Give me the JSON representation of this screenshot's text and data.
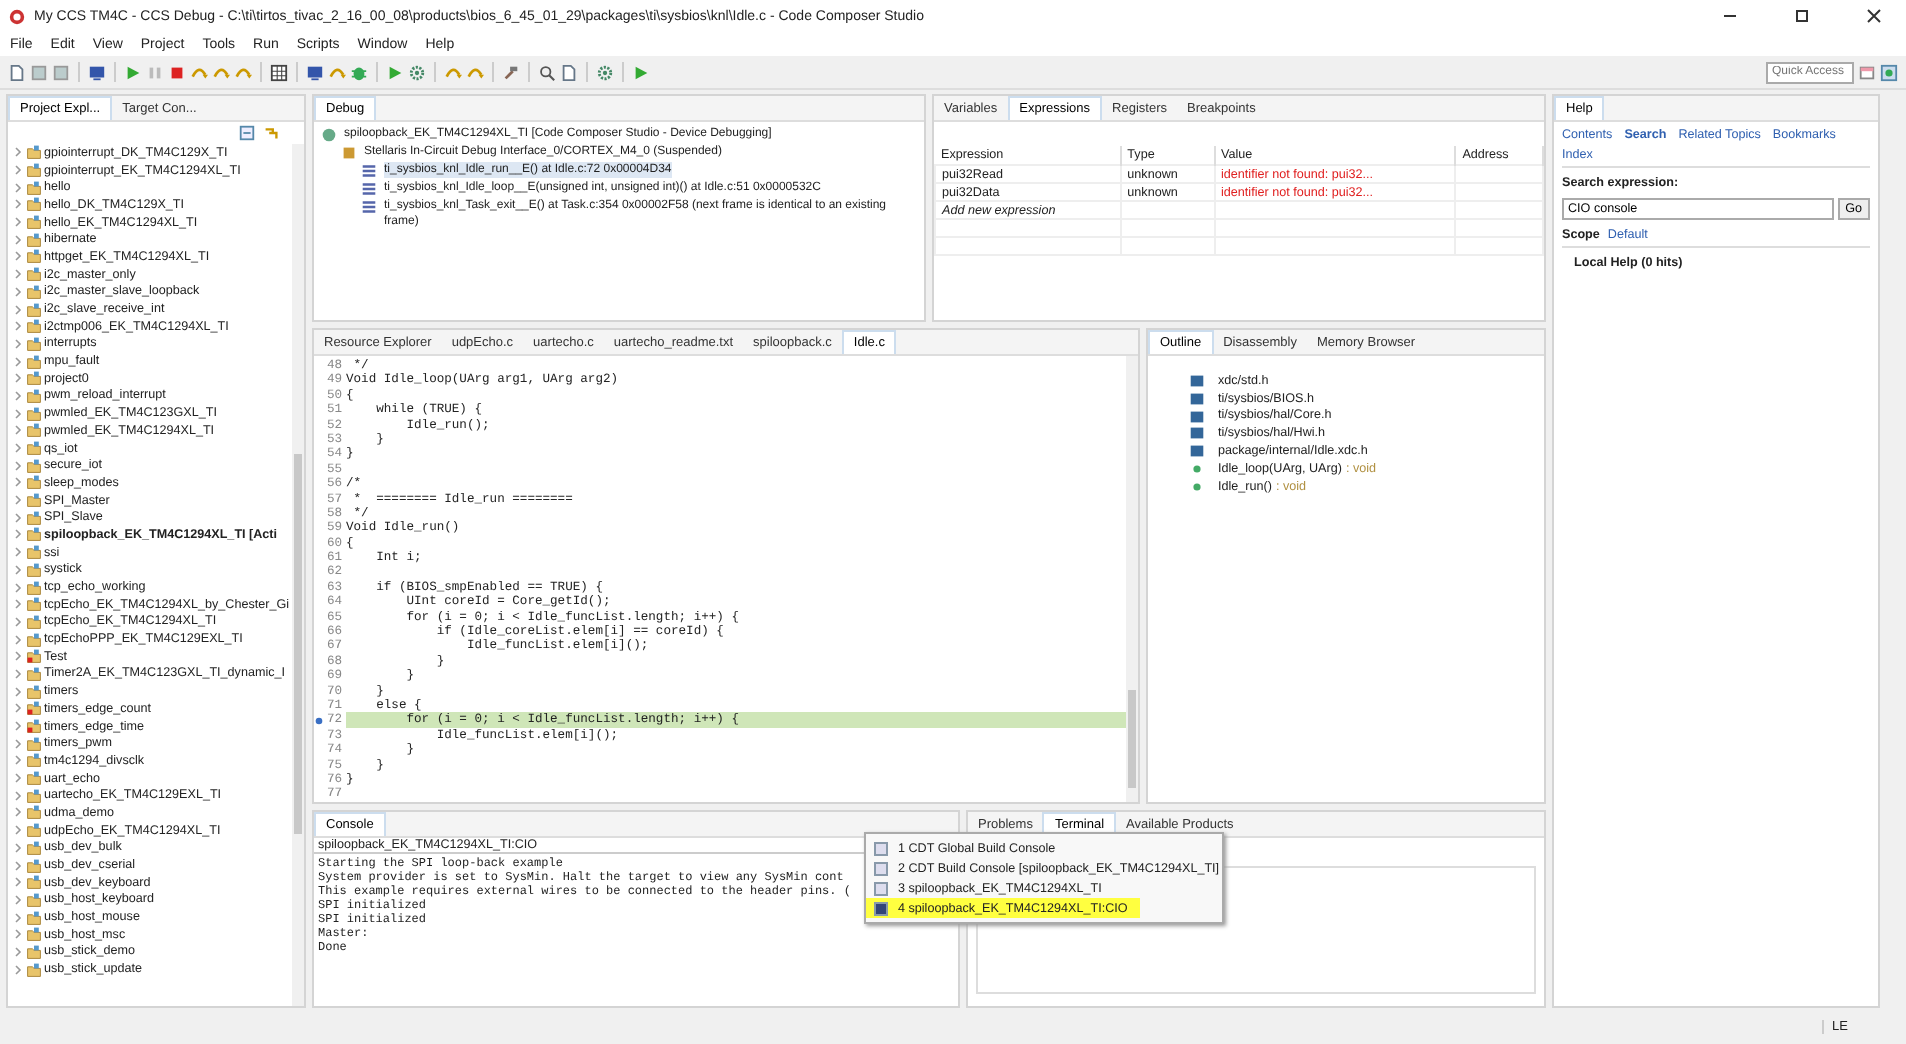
{
  "window": {
    "title": "My CCS TM4C - CCS Debug - C:\\ti\\tirtos_tivac_2_16_00_08\\products\\bios_6_45_01_29\\packages\\ti\\sysbios\\knl\\Idle.c - Code Composer Studio"
  },
  "menu": [
    "File",
    "Edit",
    "View",
    "Project",
    "Tools",
    "Run",
    "Scripts",
    "Window",
    "Help"
  ],
  "quick_access": {
    "placeholder": "Quick Access"
  },
  "project_explorer": {
    "tabs": [
      {
        "label": "Project Expl...",
        "selected": true
      },
      {
        "label": "Target Con...",
        "selected": false
      }
    ],
    "items": [
      {
        "label": "gpiointerrupt_DK_TM4C129X_TI",
        "active": false,
        "error": false
      },
      {
        "label": "gpiointerrupt_EK_TM4C1294XL_TI",
        "active": false,
        "error": false
      },
      {
        "label": "hello",
        "active": false,
        "error": false
      },
      {
        "label": "hello_DK_TM4C129X_TI",
        "active": false,
        "error": false
      },
      {
        "label": "hello_EK_TM4C1294XL_TI",
        "active": false,
        "error": false
      },
      {
        "label": "hibernate",
        "active": false,
        "error": false
      },
      {
        "label": "httpget_EK_TM4C1294XL_TI",
        "active": false,
        "error": false
      },
      {
        "label": "i2c_master_only",
        "active": false,
        "error": false
      },
      {
        "label": "i2c_master_slave_loopback",
        "active": false,
        "error": false
      },
      {
        "label": "i2c_slave_receive_int",
        "active": false,
        "error": false
      },
      {
        "label": "i2ctmp006_EK_TM4C1294XL_TI",
        "active": false,
        "error": false
      },
      {
        "label": "interrupts",
        "active": false,
        "error": false
      },
      {
        "label": "mpu_fault",
        "active": false,
        "error": false
      },
      {
        "label": "project0",
        "active": false,
        "error": false
      },
      {
        "label": "pwm_reload_interrupt",
        "active": false,
        "error": false
      },
      {
        "label": "pwmled_EK_TM4C123GXL_TI",
        "active": false,
        "error": false
      },
      {
        "label": "pwmled_EK_TM4C1294XL_TI",
        "active": false,
        "error": false
      },
      {
        "label": "qs_iot",
        "active": false,
        "error": false
      },
      {
        "label": "secure_iot",
        "active": false,
        "error": false
      },
      {
        "label": "sleep_modes",
        "active": false,
        "error": false
      },
      {
        "label": "SPI_Master",
        "active": false,
        "error": false
      },
      {
        "label": "SPI_Slave",
        "active": false,
        "error": false
      },
      {
        "label": "spiloopback_EK_TM4C1294XL_TI [Acti",
        "active": true,
        "error": false
      },
      {
        "label": "ssi",
        "active": false,
        "error": false
      },
      {
        "label": "systick",
        "active": false,
        "error": false
      },
      {
        "label": "tcp_echo_working",
        "active": false,
        "error": false
      },
      {
        "label": "tcpEcho_EK_TM4C1294XL_by_Chester_Gi",
        "active": false,
        "error": false
      },
      {
        "label": "tcpEcho_EK_TM4C1294XL_TI",
        "active": false,
        "error": false
      },
      {
        "label": "tcpEchoPPP_EK_TM4C129EXL_TI",
        "active": false,
        "error": false
      },
      {
        "label": "Test",
        "active": false,
        "error": true
      },
      {
        "label": "Timer2A_EK_TM4C123GXL_TI_dynamic_I",
        "active": false,
        "error": false
      },
      {
        "label": "timers",
        "active": false,
        "error": false
      },
      {
        "label": "timers_edge_count",
        "active": false,
        "error": true
      },
      {
        "label": "timers_edge_time",
        "active": false,
        "error": true
      },
      {
        "label": "timers_pwm",
        "active": false,
        "error": false
      },
      {
        "label": "tm4c1294_divsclk",
        "active": false,
        "error": false
      },
      {
        "label": "uart_echo",
        "active": false,
        "error": false
      },
      {
        "label": "uartecho_EK_TM4C129EXL_TI",
        "active": false,
        "error": false
      },
      {
        "label": "udma_demo",
        "active": false,
        "error": false
      },
      {
        "label": "udpEcho_EK_TM4C1294XL_TI",
        "active": false,
        "error": false
      },
      {
        "label": "usb_dev_bulk",
        "active": false,
        "error": false
      },
      {
        "label": "usb_dev_cserial",
        "active": false,
        "error": false
      },
      {
        "label": "usb_dev_keyboard",
        "active": false,
        "error": false
      },
      {
        "label": "usb_host_keyboard",
        "active": false,
        "error": false
      },
      {
        "label": "usb_host_mouse",
        "active": false,
        "error": false
      },
      {
        "label": "usb_host_msc",
        "active": false,
        "error": false
      },
      {
        "label": "usb_stick_demo",
        "active": false,
        "error": false
      },
      {
        "label": "usb_stick_update",
        "active": false,
        "error": false
      }
    ]
  },
  "debug": {
    "tabs": [
      {
        "label": "Debug",
        "selected": true
      }
    ],
    "session": "spiloopback_EK_TM4C1294XL_TI [Code Composer Studio - Device Debugging]",
    "target": "Stellaris In-Circuit Debug Interface_0/CORTEX_M4_0 (Suspended)",
    "frames": [
      {
        "label": "ti_sysbios_knl_Idle_run__E() at Idle.c:72 0x00004D34",
        "selected": true
      },
      {
        "label": "ti_sysbios_knl_Idle_loop__E(unsigned int, unsigned int)() at Idle.c:51 0x0000532C",
        "selected": false
      },
      {
        "label": "ti_sysbios_knl_Task_exit__E() at Task.c:354 0x00002F58  (next frame is identical to an existing frame)",
        "selected": false
      }
    ]
  },
  "expressions": {
    "tabs": [
      {
        "label": "Variables",
        "selected": false
      },
      {
        "label": "Expressions",
        "selected": true
      },
      {
        "label": "Registers",
        "selected": false
      },
      {
        "label": "Breakpoints",
        "selected": false
      }
    ],
    "columns": [
      "Expression",
      "Type",
      "Value",
      "Address"
    ],
    "rows": [
      {
        "expression": "pui32Read",
        "type": "unknown",
        "value": "identifier not found: pui32..."
      },
      {
        "expression": "pui32Data",
        "type": "unknown",
        "value": "identifier not found: pui32..."
      }
    ],
    "add_row": "Add new expression"
  },
  "help": {
    "tabs": [
      {
        "label": "Help",
        "selected": true
      }
    ],
    "links": [
      {
        "label": "Contents",
        "selected": false
      },
      {
        "label": "Search",
        "selected": true
      },
      {
        "label": "Related Topics",
        "selected": false
      },
      {
        "label": "Bookmarks",
        "selected": false
      }
    ],
    "index": "Index",
    "search_label": "Search expression:",
    "search_value": "CIO console",
    "go": "Go",
    "scope_label": "Scope",
    "scope_value": "Default",
    "local_help": "Local Help (0 hits)"
  },
  "editor": {
    "tabs": [
      {
        "label": "Resource Explorer",
        "selected": false
      },
      {
        "label": "udpEcho.c",
        "selected": false
      },
      {
        "label": "uartecho.c",
        "selected": false
      },
      {
        "label": "uartecho_readme.txt",
        "selected": false
      },
      {
        "label": "spiloopback.c",
        "selected": false
      },
      {
        "label": "Idle.c",
        "selected": true
      }
    ],
    "lines": [
      {
        "number": "48",
        "text": " */",
        "current": false
      },
      {
        "number": "49",
        "text": "Void Idle_loop(UArg arg1, UArg arg2)",
        "current": false
      },
      {
        "number": "50",
        "text": "{",
        "current": false
      },
      {
        "number": "51",
        "text": "    while (TRUE) {",
        "current": false
      },
      {
        "number": "52",
        "text": "        Idle_run();",
        "current": false
      },
      {
        "number": "53",
        "text": "    }",
        "current": false
      },
      {
        "number": "54",
        "text": "}",
        "current": false
      },
      {
        "number": "55",
        "current": false
      },
      {
        "number": "56",
        "text": "/*",
        "current": false
      },
      {
        "number": "57",
        "text": " *  ======== Idle_run ========",
        "current": false
      },
      {
        "number": "58",
        "text": " */",
        "current": false
      },
      {
        "number": "59",
        "text": "Void Idle_run()",
        "current": false
      },
      {
        "number": "60",
        "text": "{",
        "current": false
      },
      {
        "number": "61",
        "text": "    Int i;",
        "current": false
      },
      {
        "number": "62",
        "current": false
      },
      {
        "number": "63",
        "text": "    if (BIOS_smpEnabled == TRUE) {",
        "current": false
      },
      {
        "number": "64",
        "text": "        UInt coreId = Core_getId();",
        "current": false
      },
      {
        "number": "65",
        "text": "        for (i = 0; i < Idle_funcList.length; i++) {",
        "current": false
      },
      {
        "number": "66",
        "text": "            if (Idle_coreList.elem[i] == coreId) {",
        "current": false
      },
      {
        "number": "67",
        "text": "                Idle_funcList.elem[i]();",
        "current": false
      },
      {
        "number": "68",
        "text": "            }",
        "current": false
      },
      {
        "number": "69",
        "text": "        }",
        "current": false
      },
      {
        "number": "70",
        "text": "    }",
        "current": false
      },
      {
        "number": "71",
        "text": "    else {",
        "current": false
      },
      {
        "number": "72",
        "text": "        for (i = 0; i < Idle_funcList.length; i++) {",
        "current": true,
        "marker": true
      },
      {
        "number": "73",
        "text": "            Idle_funcList.elem[i]();",
        "current": false
      },
      {
        "number": "74",
        "text": "        }",
        "current": false
      },
      {
        "number": "75",
        "text": "    }",
        "current": false
      },
      {
        "number": "76",
        "text": "}",
        "current": false
      },
      {
        "number": "77",
        "current": false
      }
    ]
  },
  "outline": {
    "tabs": [
      {
        "label": "Outline",
        "selected": true
      },
      {
        "label": "Disassembly",
        "selected": false
      },
      {
        "label": "Memory Browser",
        "selected": false
      }
    ],
    "items": [
      {
        "kind": "include",
        "label": "xdc/std.h"
      },
      {
        "kind": "include",
        "label": "ti/sysbios/BIOS.h"
      },
      {
        "kind": "include",
        "label": "ti/sysbios/hal/Core.h"
      },
      {
        "kind": "include",
        "label": "ti/sysbios/hal/Hwi.h"
      },
      {
        "kind": "include",
        "label": "package/internal/Idle.xdc.h"
      },
      {
        "kind": "function",
        "label": "Idle_loop(UArg, UArg)",
        "type": ": void"
      },
      {
        "kind": "function",
        "label": "Idle_run()",
        "type": ": void"
      }
    ]
  },
  "console": {
    "tabs": [
      {
        "label": "Console",
        "selected": true
      }
    ],
    "header": "spiloopback_EK_TM4C1294XL_TI:CIO",
    "lines": [
      "Starting the SPI loop-back example",
      "System provider is set to SysMin. Halt the target to view any SysMin cont",
      "This example requires external wires to be connected to the header pins. (",
      "SPI initialized",
      "SPI initialized",
      "Master:",
      "Done"
    ],
    "menu": [
      {
        "label": "1 CDT Global Build Console",
        "selected": false
      },
      {
        "label": "2 CDT Build Console [spiloopback_EK_TM4C1294XL_TI]",
        "selected": false
      },
      {
        "label": "3 spiloopback_EK_TM4C1294XL_TI",
        "selected": false
      },
      {
        "label": "4 spiloopback_EK_TM4C1294XL_TI:CIO",
        "selected": true
      }
    ]
  },
  "terminal": {
    "tabs": [
      {
        "label": "Problems",
        "selected": false
      },
      {
        "label": "Terminal",
        "selected": true
      },
      {
        "label": "Available Products",
        "selected": false
      }
    ]
  },
  "status_bar": {
    "mode": "LE"
  }
}
